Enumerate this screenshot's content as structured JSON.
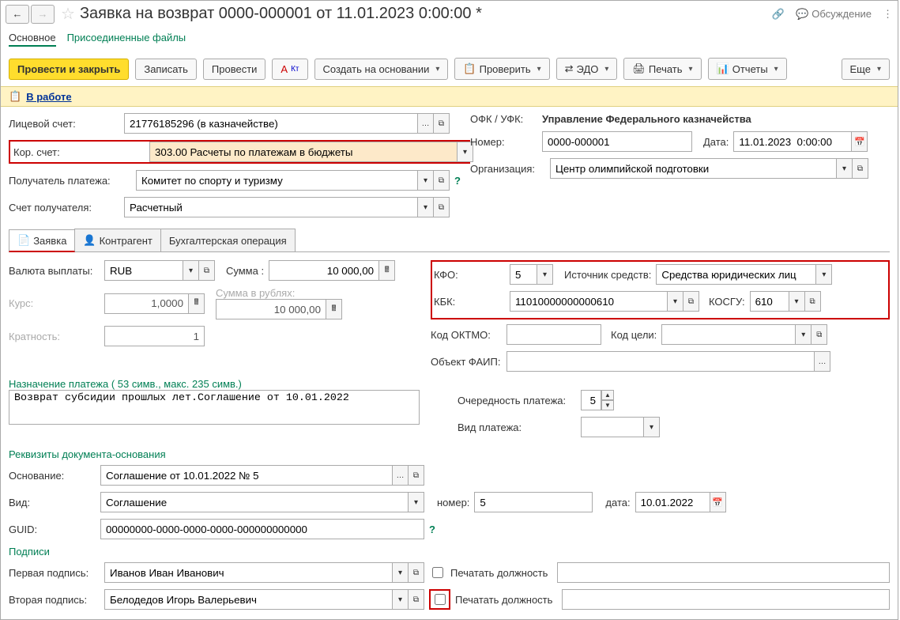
{
  "header": {
    "title": "Заявка на возврат 0000-000001 от 11.01.2023 0:00:00 *",
    "discuss": "Обсуждение"
  },
  "mainTabs": {
    "t1": "Основное",
    "t2": "Присоединенные файлы"
  },
  "toolbar": {
    "post_close": "Провести и закрыть",
    "save": "Записать",
    "post": "Провести",
    "create_based": "Создать на основании",
    "check": "Проверить",
    "edo": "ЭДО",
    "print": "Печать",
    "reports": "Отчеты",
    "more": "Еще"
  },
  "status": {
    "label": "В работе"
  },
  "f": {
    "acct_lbl": "Лицевой счет:",
    "acct_val": "21776185296 (в казначействе)",
    "ofk_lbl": "ОФК / УФК:",
    "ofk_val": "Управление Федерального казначейства",
    "kor_lbl": "Кор. счет:",
    "kor_val": "303.00 Расчеты по платежам в бюджеты",
    "num_lbl": "Номер:",
    "num_val": "0000-000001",
    "date_lbl": "Дата:",
    "date_val": "11.01.2023  0:00:00",
    "payee_lbl": "Получатель платежа:",
    "payee_val": "Комитет по спорту и туризму",
    "org_lbl": "Организация:",
    "org_val": "Центр олимпийской подготовки",
    "payee_acct_lbl": "Счет получателя:",
    "payee_acct_val": "Расчетный"
  },
  "tabs": {
    "t1": "Заявка",
    "t2": "Контрагент",
    "t3": "Бухгалтерская операция"
  },
  "z": {
    "cur_lbl": "Валюта выплаты:",
    "cur_val": "RUB",
    "sum_lbl": "Сумма :",
    "sum_val": "10 000,00",
    "rate_lbl": "Курс:",
    "rate_val": "1,0000",
    "sum_rub_lbl": "Сумма в рублях:",
    "sum_rub_val": "10 000,00",
    "mult_lbl": "Кратность:",
    "mult_val": "1",
    "kfo_lbl": "КФО:",
    "kfo_val": "5",
    "src_lbl": "Источник средств:",
    "src_val": "Средства юридических лиц",
    "kbk_lbl": "КБК:",
    "kbk_val": "11010000000000610",
    "kosgu_lbl": "КОСГУ:",
    "kosgu_val": "610",
    "oktmo_lbl": "Код ОКТМО:",
    "goal_lbl": "Код цели:",
    "faip_lbl": "Объект ФАИП:",
    "purpose_hint": "Назначение платежа ( 53 симв., макс. 235 симв.)",
    "purpose_val": "Возврат субсидии прошлых лет.Соглашение от 10.01.2022",
    "prio_lbl": "Очередность платежа:",
    "prio_val": "5",
    "ptype_lbl": "Вид платежа:",
    "basis_title": "Реквизиты документа-основания",
    "basis_lbl": "Основание:",
    "basis_val": "Соглашение от 10.01.2022 № 5",
    "kind_lbl": "Вид:",
    "kind_val": "Соглашение",
    "bnum_lbl": "номер:",
    "bnum_val": "5",
    "bdate_lbl": "дата:",
    "bdate_val": "10.01.2022",
    "guid_lbl": "GUID:",
    "guid_val": "00000000-0000-0000-0000-000000000000",
    "sign_title": "Подписи",
    "sign1_lbl": "Первая подпись:",
    "sign1_val": "Иванов Иван Иванович",
    "sign2_lbl": "Вторая подпись:",
    "sign2_val": "Белодедов Игорь Валерьевич",
    "print_pos": "Печатать должность"
  }
}
